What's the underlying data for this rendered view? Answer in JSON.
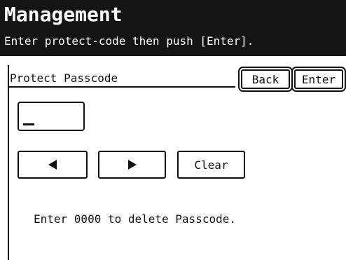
{
  "header": {
    "title": "Management",
    "instruction": "Enter protect-code then push [Enter]."
  },
  "panel": {
    "label": "Protect Passcode"
  },
  "buttons": {
    "back": "Back",
    "enter": "Enter",
    "clear": "Clear"
  },
  "icons": {
    "left": "arrow-left-icon",
    "right": "arrow-right-icon"
  },
  "note": "Enter 0000 to delete Passcode.",
  "colors": {
    "header_bg": "#141414",
    "header_text": "#ffffff",
    "border": "#111111"
  }
}
